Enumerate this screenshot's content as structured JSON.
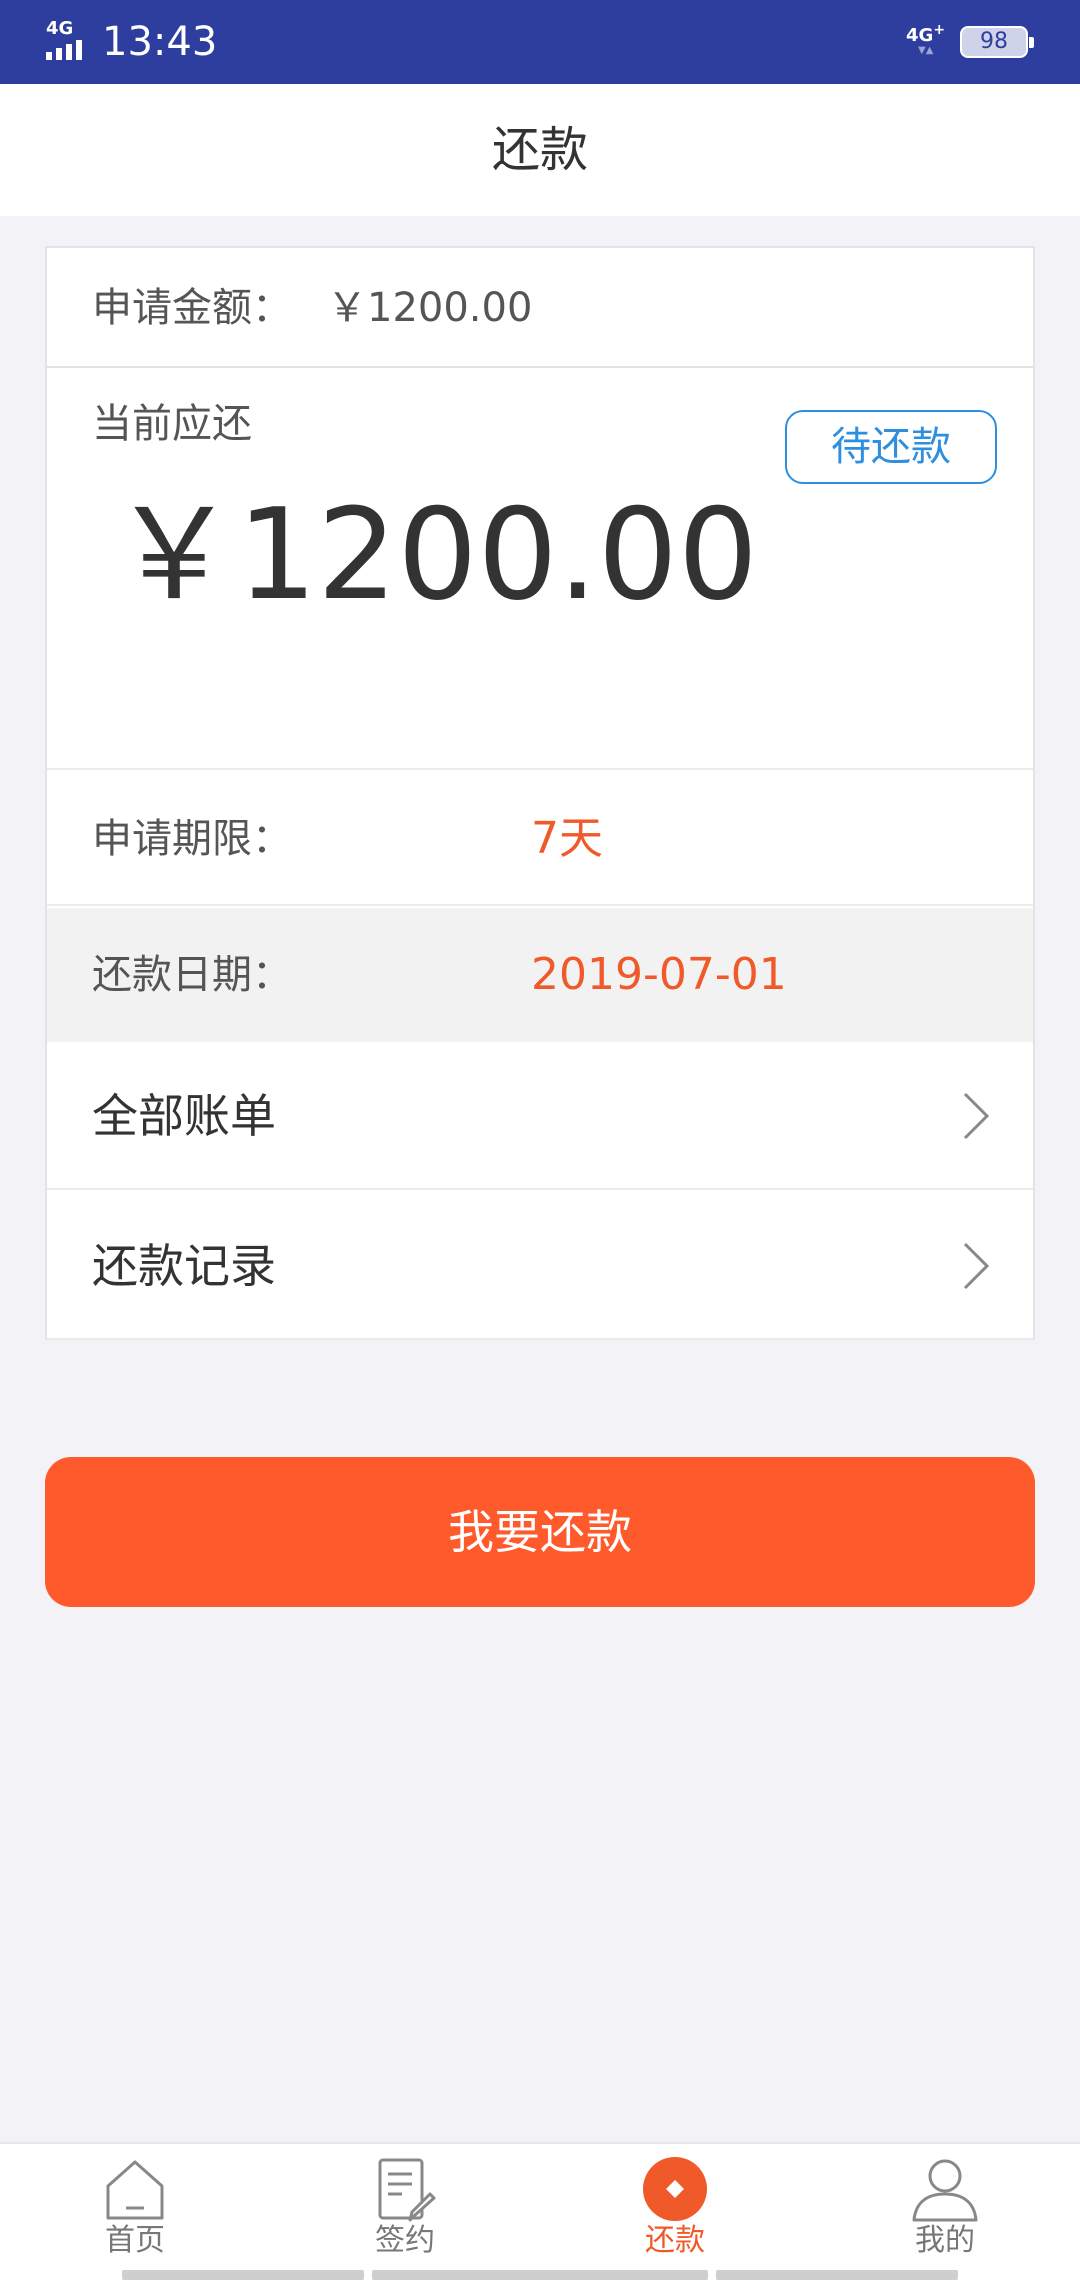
{
  "status_bar": {
    "network_left": "4G",
    "time": "13:43",
    "network_right": "4G",
    "network_right_superscript": "+",
    "battery": "98",
    "background_color": "#2e3e9f"
  },
  "header": {
    "title": "还款"
  },
  "card": {
    "apply_amount_label": "申请金额：",
    "apply_amount_value": "￥1200.00",
    "current_due_label": "当前应还",
    "status_badge": "待还款",
    "current_due_amount": "￥1200.00",
    "term_label": "申请期限：",
    "term_value": "7天",
    "due_date_label": "还款日期：",
    "due_date_value": "2019-07-01",
    "links": [
      {
        "label": "全部账单",
        "icon": "chevron-right-icon"
      },
      {
        "label": "还款记录",
        "icon": "chevron-right-icon"
      }
    ]
  },
  "primary_button": {
    "label": "我要还款",
    "color": "#ff5a2c"
  },
  "tabbar": {
    "tabs": [
      {
        "label": "首页",
        "icon": "home-icon",
        "active": false
      },
      {
        "label": "签约",
        "icon": "document-edit-icon",
        "active": false
      },
      {
        "label": "还款",
        "icon": "repay-icon",
        "active": true
      },
      {
        "label": "我的",
        "icon": "user-icon",
        "active": false
      }
    ],
    "active_color": "#f0592a"
  }
}
